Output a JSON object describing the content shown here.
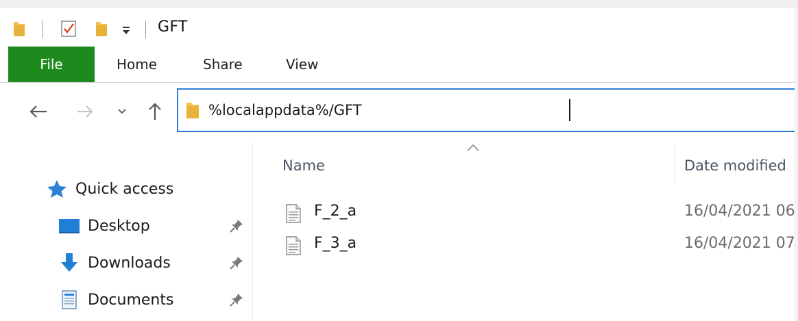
{
  "window": {
    "title": "GFT"
  },
  "ribbon": {
    "tabs": [
      {
        "label": "File",
        "active": true
      },
      {
        "label": "Home"
      },
      {
        "label": "Share"
      },
      {
        "label": "View"
      }
    ],
    "file_tab_color": "#1e8a1e"
  },
  "address": {
    "value": "%localappdata%/GFT",
    "border_color": "#2f7fd4"
  },
  "nav_pane": {
    "items": [
      {
        "label": "Quick access",
        "icon": "star-icon"
      },
      {
        "label": "Desktop",
        "icon": "desktop-icon",
        "pinned": true
      },
      {
        "label": "Downloads",
        "icon": "download-arrow-icon",
        "pinned": true
      },
      {
        "label": "Documents",
        "icon": "documents-icon",
        "pinned": true
      }
    ]
  },
  "file_list": {
    "columns": [
      {
        "label": "Name",
        "sorted": "ascending"
      },
      {
        "label": "Date modified"
      }
    ],
    "files": [
      {
        "name": "F_2_a",
        "date_modified": "16/04/2021 06"
      },
      {
        "name": "F_3_a",
        "date_modified": "16/04/2021 07"
      }
    ]
  }
}
